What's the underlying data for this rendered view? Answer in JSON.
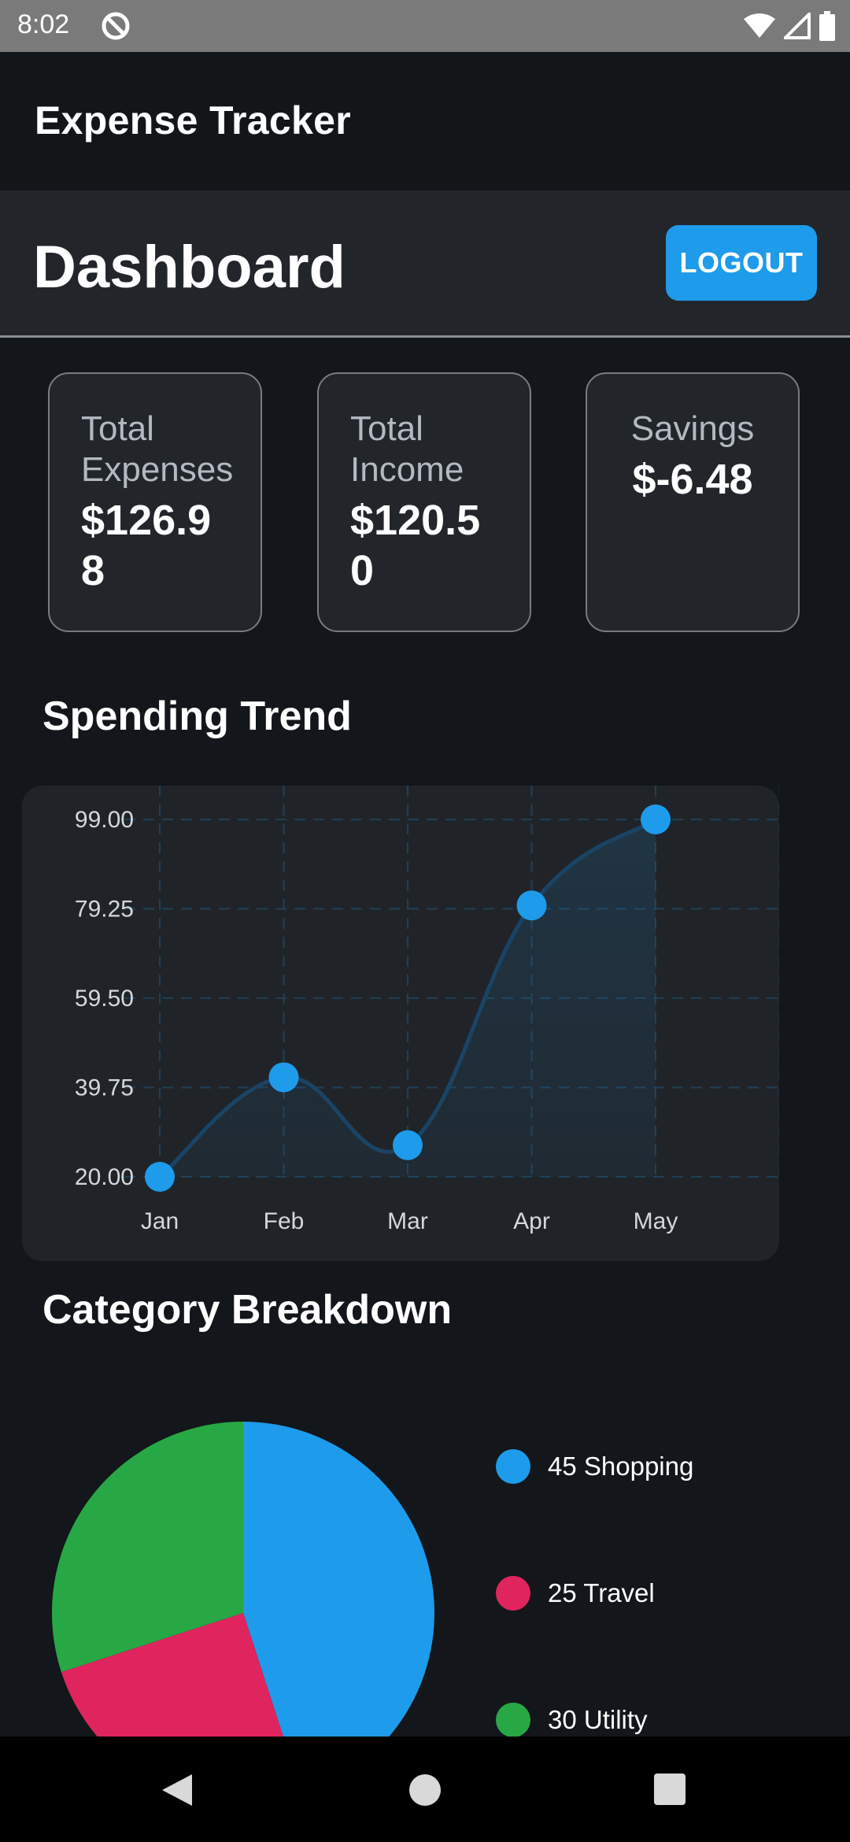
{
  "status_bar": {
    "time": "8:02"
  },
  "app": {
    "title": "Expense Tracker"
  },
  "header": {
    "title": "Dashboard",
    "logout_label": "LOGOUT"
  },
  "summary": [
    {
      "label": "Total Expenses",
      "value": "$126.98"
    },
    {
      "label": "Total Income",
      "value": "$120.50"
    },
    {
      "label": "Savings",
      "value": "$-6.48"
    }
  ],
  "sections": {
    "trend": "Spending Trend",
    "breakdown": "Category Breakdown"
  },
  "colors": {
    "accent": "#1e9bea",
    "shopping": "#1e9bea",
    "travel": "#e0245e",
    "utility": "#27a844"
  },
  "chart_data": [
    {
      "type": "area",
      "categories": [
        "Jan",
        "Feb",
        "Mar",
        "Apr",
        "May"
      ],
      "values": [
        20,
        42,
        27,
        80,
        99
      ],
      "y_ticks": [
        "20.00",
        "39.75",
        "59.50",
        "79.25",
        "99.00"
      ],
      "ylim": [
        20,
        99
      ],
      "grid": true,
      "color": "#1e9bea"
    },
    {
      "type": "pie",
      "slices": [
        {
          "label": "Shopping",
          "value": 45,
          "color": "#1e9bea"
        },
        {
          "label": "Travel",
          "value": 25,
          "color": "#e0245e"
        },
        {
          "label": "Utility",
          "value": 30,
          "color": "#27a844"
        }
      ],
      "legend": [
        "45 Shopping",
        "25 Travel",
        "30 Utility"
      ]
    }
  ]
}
